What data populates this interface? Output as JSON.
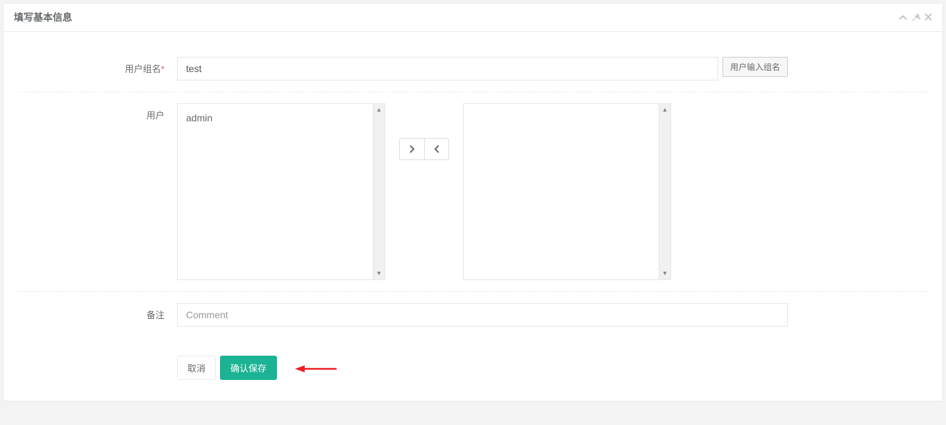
{
  "panel": {
    "title": "填写基本信息"
  },
  "form": {
    "group_name": {
      "label": "用户组名",
      "value": "test",
      "hint": "用户输入组名"
    },
    "users": {
      "label": "用户",
      "available": [
        "admin"
      ],
      "selected": []
    },
    "comment": {
      "label": "备注",
      "placeholder": "Comment",
      "value": ""
    },
    "buttons": {
      "cancel": "取消",
      "save": "确认保存"
    }
  }
}
